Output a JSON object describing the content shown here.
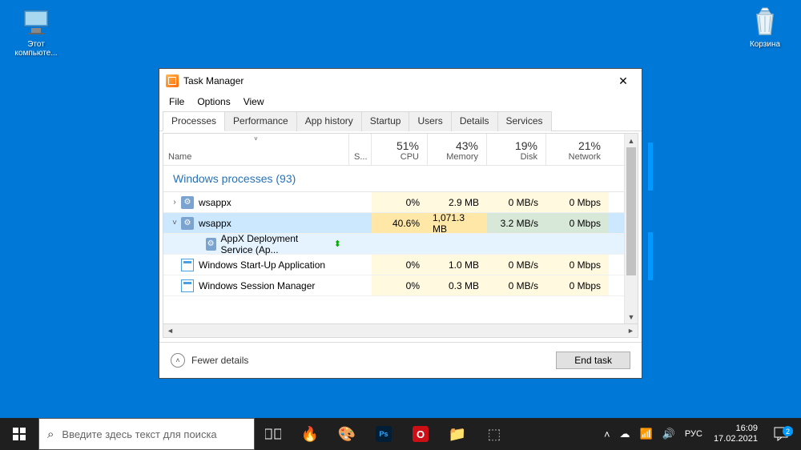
{
  "desktop": {
    "pc_label": "Этот\nкомпьюте...",
    "bin_label": "Корзина"
  },
  "taskmgr": {
    "title": "Task Manager",
    "menu": [
      "File",
      "Options",
      "View"
    ],
    "tabs": [
      "Processes",
      "Performance",
      "App history",
      "Startup",
      "Users",
      "Details",
      "Services"
    ],
    "header": {
      "name": "Name",
      "status": "S...",
      "cpu": {
        "pct": "51%",
        "label": "CPU"
      },
      "mem": {
        "pct": "43%",
        "label": "Memory"
      },
      "disk": {
        "pct": "19%",
        "label": "Disk"
      },
      "net": {
        "pct": "21%",
        "label": "Network"
      }
    },
    "group": "Windows processes (93)",
    "rows": [
      {
        "exp": "›",
        "icon": "gear",
        "name": "wsappx",
        "cpu": "0%",
        "mem": "2.9 MB",
        "disk": "0 MB/s",
        "net": "0 Mbps",
        "cls": ""
      },
      {
        "exp": "˅",
        "icon": "gear",
        "name": "wsappx",
        "cpu": "40.6%",
        "mem": "1,071.3 MB",
        "disk": "3.2 MB/s",
        "net": "0 Mbps",
        "cls": "sel hot"
      },
      {
        "exp": "",
        "icon": "gear",
        "name": "AppX Deployment Service (Ap...",
        "cpu": "",
        "mem": "",
        "disk": "",
        "net": "",
        "cls": "child",
        "indent": true,
        "leaf": true
      },
      {
        "exp": "",
        "icon": "win",
        "name": "Windows Start-Up Application",
        "cpu": "0%",
        "mem": "1.0 MB",
        "disk": "0 MB/s",
        "net": "0 Mbps",
        "cls": ""
      },
      {
        "exp": "",
        "icon": "win",
        "name": "Windows Session Manager",
        "cpu": "0%",
        "mem": "0.3 MB",
        "disk": "0 MB/s",
        "net": "0 Mbps",
        "cls": ""
      }
    ],
    "fewer": "Fewer details",
    "endtask": "End task"
  },
  "taskbar": {
    "search_placeholder": "Введите здесь текст для поиска",
    "lang": "РУС",
    "time": "16:09",
    "date": "17.02.2021",
    "notif_count": "2"
  }
}
